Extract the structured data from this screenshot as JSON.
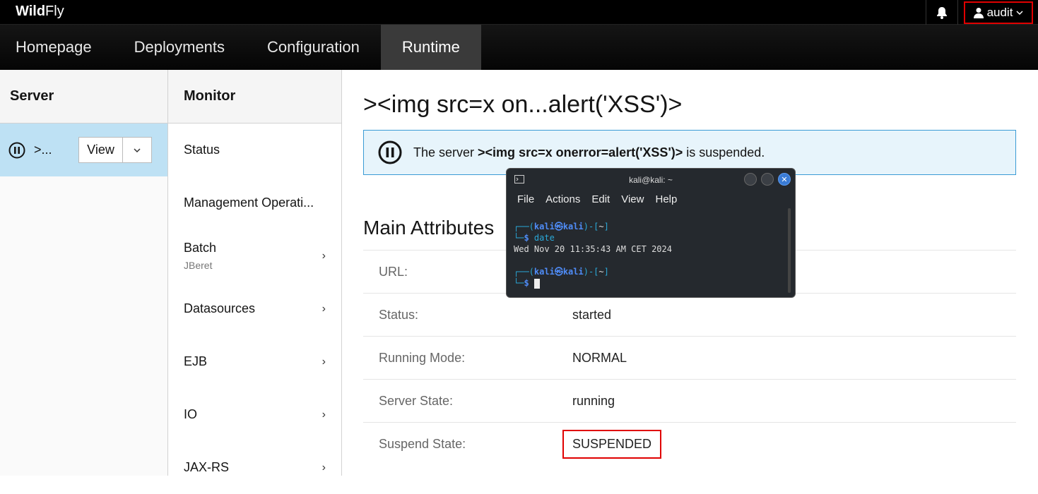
{
  "brand": {
    "bold": "Wild",
    "normal": "Fly"
  },
  "user": {
    "name": "audit"
  },
  "nav": {
    "items": [
      "Homepage",
      "Deployments",
      "Configuration",
      "Runtime"
    ],
    "active": "Runtime"
  },
  "server_col": {
    "title": "Server",
    "row_name": ">...",
    "view_label": "View"
  },
  "monitor_col": {
    "title": "Monitor",
    "items": [
      {
        "label": "Status",
        "sub": ""
      },
      {
        "label": "Management Operati...",
        "sub": ""
      },
      {
        "label": "Batch",
        "sub": "JBeret"
      },
      {
        "label": "Datasources",
        "sub": ""
      },
      {
        "label": "EJB",
        "sub": ""
      },
      {
        "label": "IO",
        "sub": ""
      },
      {
        "label": "JAX-RS",
        "sub": ""
      }
    ]
  },
  "main": {
    "title": "><img src=x on...alert('XSS')>",
    "alert": {
      "prefix": "The server ",
      "server": "><img src=x onerror=alert('XSS')>",
      "suffix": " is suspended."
    },
    "section": "Main Attributes",
    "attributes": [
      {
        "key": "URL:",
        "value": ""
      },
      {
        "key": "Status:",
        "value": "started"
      },
      {
        "key": "Running Mode:",
        "value": "NORMAL"
      },
      {
        "key": "Server State:",
        "value": "running"
      },
      {
        "key": "Suspend State:",
        "value": "SUSPENDED"
      }
    ]
  },
  "terminal": {
    "title": "kali@kali: ~",
    "menu": [
      "File",
      "Actions",
      "Edit",
      "View",
      "Help"
    ],
    "user": "kali",
    "host": "kali",
    "dir": "~",
    "command": "date",
    "output": "Wed Nov 20 11:35:43 AM CET 2024"
  }
}
